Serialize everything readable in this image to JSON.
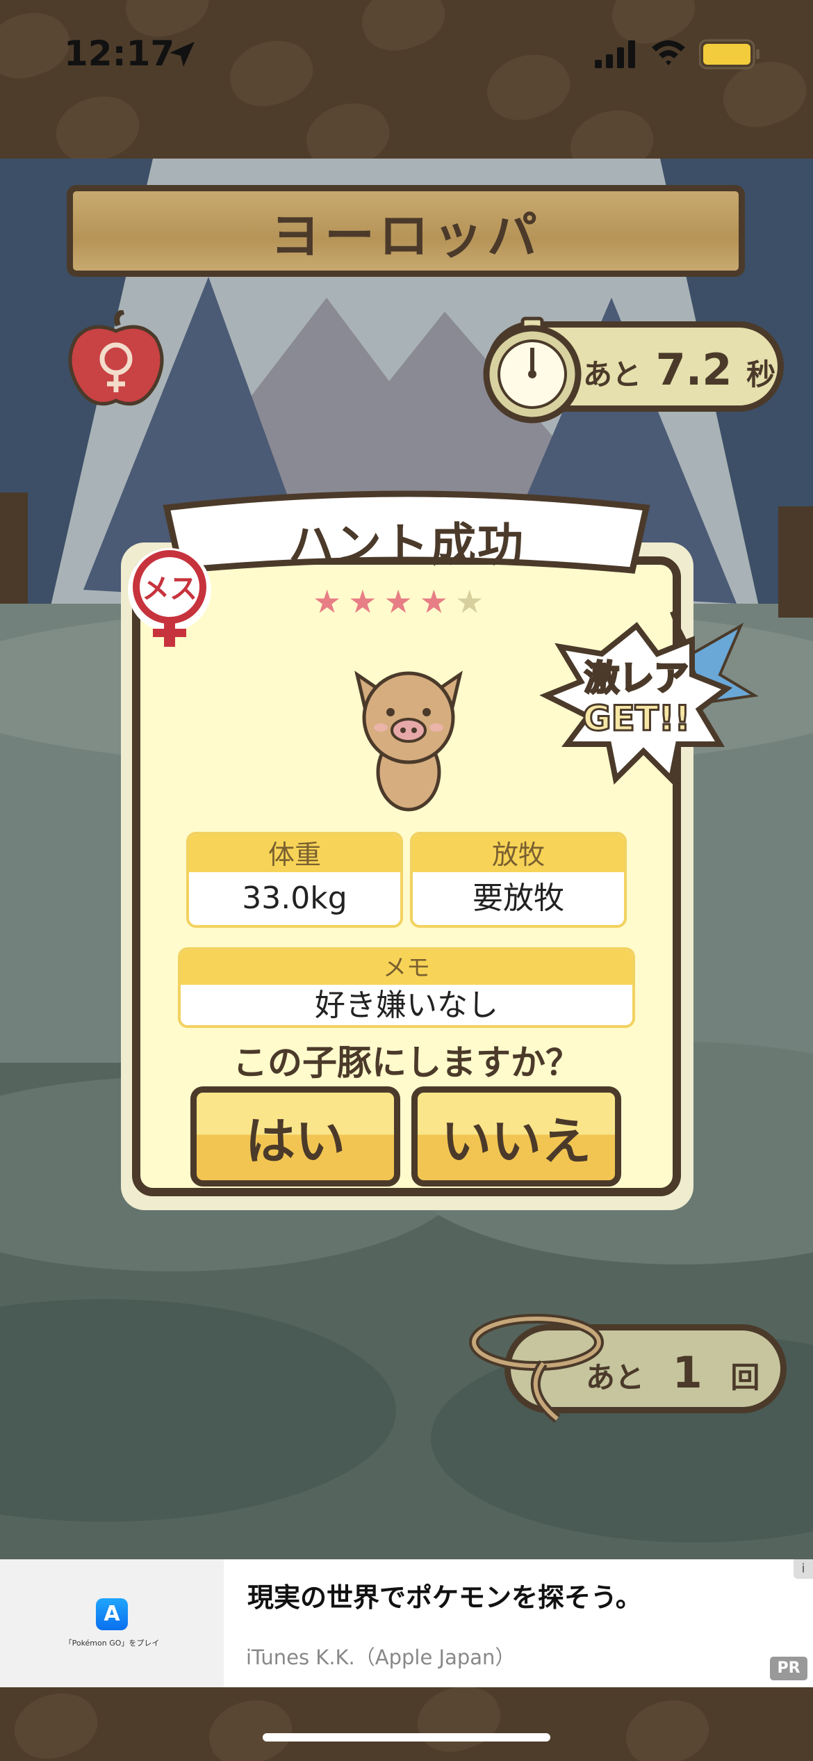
{
  "status_bar": {
    "time": "12:17"
  },
  "game": {
    "region_title": "ヨーロッパ",
    "timer": {
      "prefix": "あと",
      "value": "7.2",
      "unit": "秒"
    },
    "tries": {
      "prefix": "あと",
      "value": "1",
      "unit": "回"
    },
    "result": {
      "title": "ハント成功",
      "stars_filled": 4,
      "stars_total": 5,
      "gender_badge": "メス",
      "rare_badge_line1": "激レア",
      "rare_badge_line2": "GET!!",
      "weight_label": "体重",
      "weight_value": "33.0kg",
      "pasture_label": "放牧",
      "pasture_value": "要放牧",
      "memo_label": "メモ",
      "memo_value": "好き嫌いなし",
      "question": "この子豚にしますか？",
      "yes_label": "はい",
      "no_label": "いいえ"
    }
  },
  "ad": {
    "title": "現実の世界でポケモンを探そう。",
    "subtitle": "iTunes K.K.（Apple Japan）",
    "small_caption": "「Pokémon GO」をプレイ",
    "info": "i",
    "pr": "PR"
  },
  "colors": {
    "brown": "#4b3a2a",
    "card_bg": "#fffbcc",
    "gold": "#f7d457",
    "star_on": "#e77e85",
    "star_off": "#d8cf9e"
  }
}
